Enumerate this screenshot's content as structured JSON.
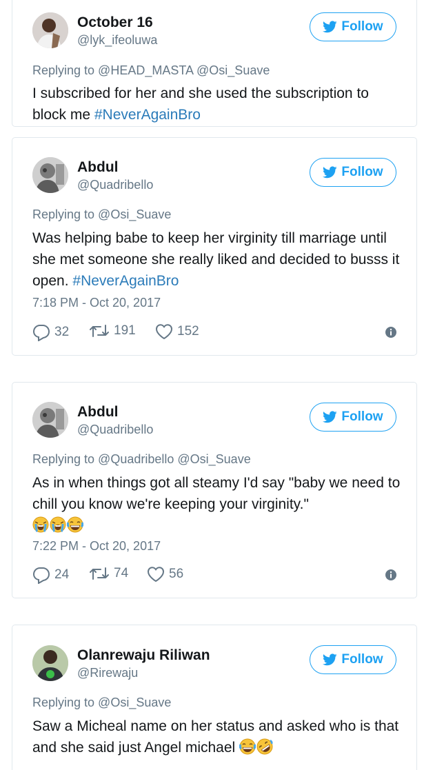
{
  "tweets": [
    {
      "name": "October 16",
      "handle": "@lyk_ifeoluwa",
      "follow_label": "Follow",
      "replying_to": "Replying to @HEAD_MASTA @Osi_Suave",
      "text": "I subscribed for her and she used the subscription to block me ",
      "hashtag": "#NeverAgainBro"
    },
    {
      "name": "Abdul",
      "handle": "@Quadribello",
      "follow_label": "Follow",
      "replying_to": "Replying to @Osi_Suave",
      "text": "Was helping babe to keep her virginity till marriage until she met someone she really liked and decided to busss it open. ",
      "hashtag": "#NeverAgainBro",
      "time": "7:18 PM - Oct 20, 2017",
      "replies": "32",
      "retweets": "191",
      "likes": "152"
    },
    {
      "name": "Abdul",
      "handle": "@Quadribello",
      "follow_label": "Follow",
      "replying_to": "Replying to @Quadribello @Osi_Suave",
      "text": "As in when things got all steamy I'd say \"baby we need to chill you know we're keeping your virginity.\"",
      "emojis": [
        "loudly-crying-face",
        "loudly-crying-face",
        "face-with-tears-of-joy"
      ],
      "time": "7:22 PM - Oct 20, 2017",
      "replies": "24",
      "retweets": "74",
      "likes": "56"
    },
    {
      "name": "Olanrewaju Riliwan",
      "handle": "@Rirewaju",
      "follow_label": "Follow",
      "replying_to": "Replying to @Osi_Suave",
      "text": "Saw a Micheal name on her status and asked who is that and she said just Angel michael ",
      "emojis": [
        "face-with-tears-of-joy",
        "rolling-on-floor-laughing"
      ]
    }
  ],
  "icons": {
    "follow": "twitter-bird-icon",
    "reply": "reply-icon",
    "retweet": "retweet-icon",
    "like": "heart-icon",
    "info": "info-icon"
  },
  "colors": {
    "accent": "#1da1f2",
    "hashtag": "#2b7bb9",
    "secondary_text": "#657786",
    "border": "#e1e8ed"
  }
}
